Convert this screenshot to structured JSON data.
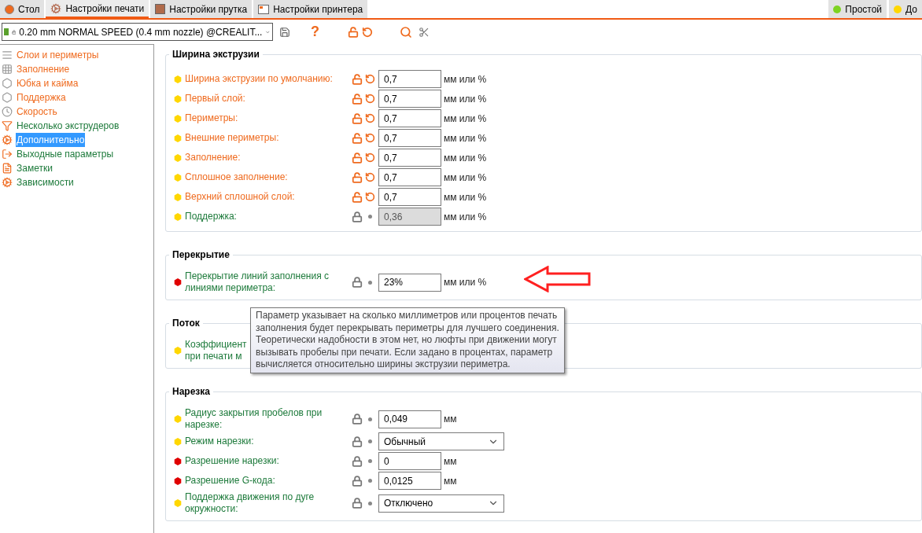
{
  "tabs": [
    {
      "label": "Стол",
      "selected": false
    },
    {
      "label": "Настройки печати",
      "selected": true
    },
    {
      "label": "Настройки прутка",
      "selected": false
    },
    {
      "label": "Настройки принтера",
      "selected": false
    }
  ],
  "mode_buttons": [
    {
      "label": "Простой",
      "color": "#7ed321"
    },
    {
      "label": "До",
      "color": "#ffd700"
    }
  ],
  "toolbar": {
    "preset": "0.20 mm NORMAL SPEED (0.4 mm nozzle) @CREALIT...",
    "help": "?"
  },
  "sidebar": {
    "items": [
      {
        "label": "Слои и периметры",
        "modified": true,
        "selected": false
      },
      {
        "label": "Заполнение",
        "modified": true,
        "selected": false
      },
      {
        "label": "Юбка и кайма",
        "modified": true,
        "selected": false
      },
      {
        "label": "Поддержка",
        "modified": true,
        "selected": false
      },
      {
        "label": "Скорость",
        "modified": true,
        "selected": false
      },
      {
        "label": "Несколько экструдеров",
        "modified": false,
        "selected": false
      },
      {
        "label": "Дополнительно",
        "modified": false,
        "selected": true
      },
      {
        "label": "Выходные параметры",
        "modified": false,
        "selected": false
      },
      {
        "label": "Заметки",
        "modified": false,
        "selected": false
      },
      {
        "label": "Зависимости",
        "modified": false,
        "selected": false
      }
    ]
  },
  "sections": [
    {
      "title": "Ширина экструзии",
      "rows": [
        {
          "kind": "input",
          "label": "Ширина экструзии по умолчанию:",
          "color": "#ffd700",
          "modified": true,
          "disabled": false,
          "value": "0,7",
          "unit": "мм или %"
        },
        {
          "kind": "input",
          "label": "Первый слой:",
          "color": "#ffd700",
          "modified": true,
          "disabled": false,
          "value": "0,7",
          "unit": "мм или %"
        },
        {
          "kind": "input",
          "label": "Периметры:",
          "color": "#ffd700",
          "modified": true,
          "disabled": false,
          "value": "0,7",
          "unit": "мм или %"
        },
        {
          "kind": "input",
          "label": "Внешние периметры:",
          "color": "#ffd700",
          "modified": true,
          "disabled": false,
          "value": "0,7",
          "unit": "мм или %"
        },
        {
          "kind": "input",
          "label": "Заполнение:",
          "color": "#ffd700",
          "modified": true,
          "disabled": false,
          "value": "0,7",
          "unit": "мм или %"
        },
        {
          "kind": "input",
          "label": "Сплошное заполнение:",
          "color": "#ffd700",
          "modified": true,
          "disabled": false,
          "value": "0,7",
          "unit": "мм или %"
        },
        {
          "kind": "input",
          "label": "Верхний сплошной слой:",
          "color": "#ffd700",
          "modified": true,
          "disabled": false,
          "value": "0,7",
          "unit": "мм или %"
        },
        {
          "kind": "input",
          "label": "Поддержка:",
          "color": "#ffd700",
          "modified": false,
          "disabled": true,
          "value": "0,36",
          "unit": "мм или %"
        }
      ]
    },
    {
      "title": "Перекрытие",
      "rows": [
        {
          "kind": "input",
          "label": "Перекрытие линий заполнения с\nлиниями периметра:",
          "color": "#e00000",
          "modified": false,
          "disabled": false,
          "value": "23%",
          "unit": "мм или %"
        }
      ]
    },
    {
      "title": "Поток",
      "rows": [
        {
          "kind": "covered",
          "label": "Коэффициент\nпри печати м",
          "color": "#ffd700",
          "modified": false
        }
      ]
    },
    {
      "title": "Нарезка",
      "rows": [
        {
          "kind": "input",
          "label": "Радиус закрытия пробелов при\nнарезке:",
          "color": "#ffd700",
          "modified": false,
          "disabled": false,
          "value": "0,049",
          "unit": "мм"
        },
        {
          "kind": "select",
          "label": "Режим нарезки:",
          "color": "#ffd700",
          "modified": false,
          "value": "Обычный"
        },
        {
          "kind": "input",
          "label": "Разрешение нарезки:",
          "color": "#e00000",
          "modified": false,
          "disabled": false,
          "value": "0",
          "unit": "мм"
        },
        {
          "kind": "input",
          "label": "Разрешение G-кода:",
          "color": "#e00000",
          "modified": false,
          "disabled": false,
          "value": "0,0125",
          "unit": "мм"
        },
        {
          "kind": "select",
          "label": "Поддержка движения по дуге\nокружности:",
          "color": "#ffd700",
          "modified": false,
          "value": "Отключено"
        }
      ]
    }
  ],
  "tooltip": {
    "text": "Параметр указывает на сколько миллиметров или процентов печать\nзаполнения будет перекрывать периметры для лучшего соединения.\nТеоретически надобности в этом нет, но люфты при движении могут\nвызывать пробелы при печати. Если задано в процентах, параметр\nвычисляется относительно ширины экструзии периметра."
  }
}
